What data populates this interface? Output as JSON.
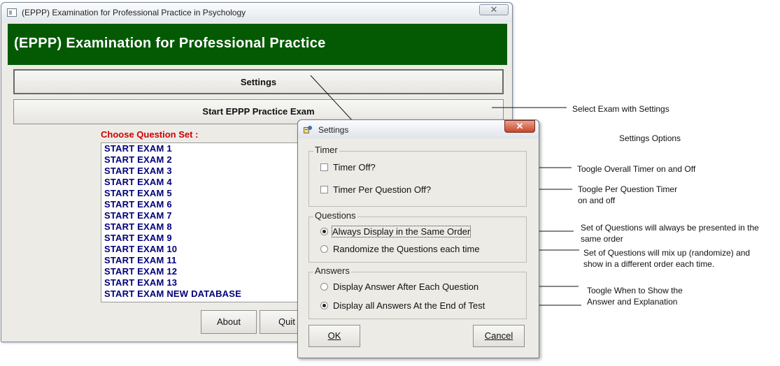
{
  "main_window": {
    "title": "(EPPP) Examination for Professional Practice in Psychology",
    "close_glyph": "✕",
    "header": "(EPPP) Examination for Professional Practice",
    "settings_label": "Settings",
    "start_label": "Start EPPP Practice Exam",
    "choose_label": "Choose Question Set :",
    "exams": [
      "START EXAM 1",
      "START EXAM 2",
      "START EXAM 3",
      "START EXAM 4",
      "START EXAM 5",
      "START EXAM 6",
      "START EXAM 7",
      "START EXAM 8",
      "START EXAM 9",
      "START EXAM 10",
      "START EXAM 11",
      "START EXAM 12",
      "START EXAM 13",
      "START EXAM NEW DATABASE"
    ],
    "about_label": "About",
    "quit_label": "Quit"
  },
  "settings_dialog": {
    "title": "Settings",
    "close_glyph": "✕",
    "timer": {
      "label": "Timer",
      "timer_off": "Timer Off?",
      "timer_per_question_off": "Timer Per Question Off?",
      "timer_off_checked": false,
      "timer_per_question_checked": false
    },
    "questions": {
      "label": "Questions",
      "same_order": "Always Display in the Same Order",
      "randomize": "Randomize the Questions each time",
      "selected": "same_order"
    },
    "answers": {
      "label": "Answers",
      "after_each": "Display Answer After Each Question",
      "at_end": "Display all Answers At the End of Test",
      "selected": "at_end"
    },
    "ok_label": "OK",
    "cancel_label": "Cancel"
  },
  "annotations": {
    "select_exam": "Select Exam with Settings",
    "settings_options": "Settings Options",
    "overall_timer": "Toogle Overall Timer on and Off",
    "per_question_timer_1": "Toogle Per Question Timer",
    "per_question_timer_2": "on and off",
    "same_order_1": "Set of Questions will always be presented in the",
    "same_order_2": "same order",
    "randomize_1": "Set of Questions will mix up (randomize) and",
    "randomize_2": "show in a different order each time.",
    "answers_1": "Toogle When to Show the",
    "answers_2": "Answer and Explanation"
  },
  "colors": {
    "header_green": "#035a03",
    "choose_red": "#d00000",
    "exam_text_navy": "#00007a"
  }
}
